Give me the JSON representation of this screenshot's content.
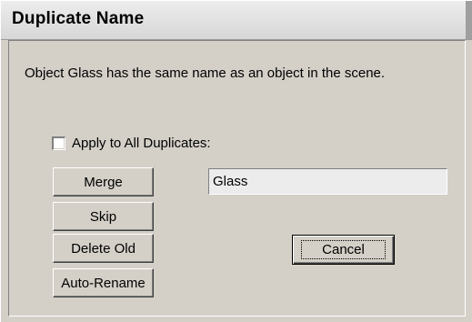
{
  "window": {
    "title": "Duplicate Name"
  },
  "dialog": {
    "message": "Object Glass has the same name as an object in the scene.",
    "apply_all": {
      "label": "Apply to All Duplicates:",
      "checked": false
    },
    "buttons": {
      "merge": "Merge",
      "skip": "Skip",
      "delete_old": "Delete Old",
      "auto_rename": "Auto-Rename",
      "cancel": "Cancel"
    },
    "name_field": {
      "value": "Glass"
    }
  }
}
